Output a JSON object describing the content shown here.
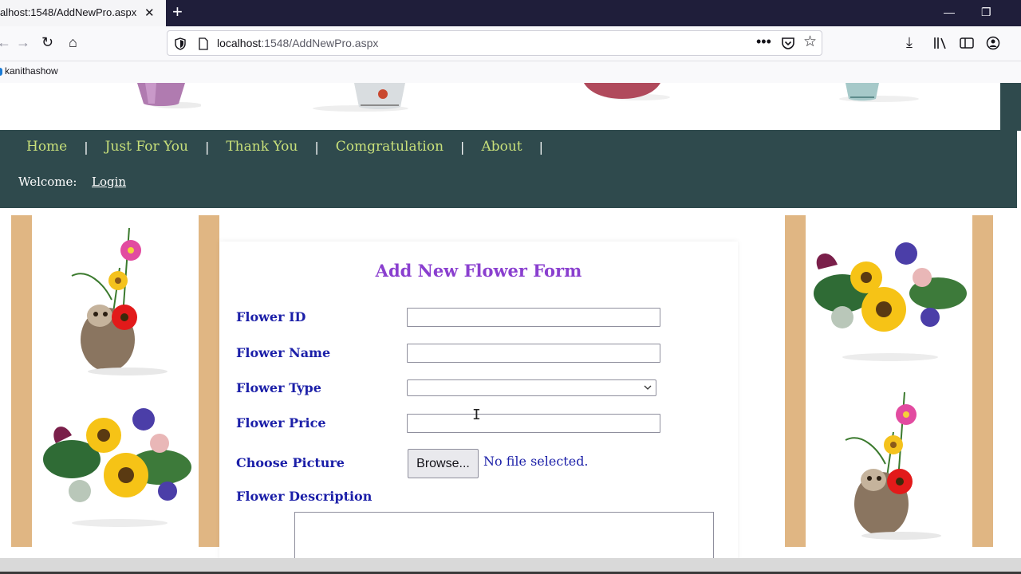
{
  "browser": {
    "tab_title": "alhost:1548/AddNewPro.aspx",
    "url_prefix": "localhost",
    "url_rest": ":1548/AddNewPro.aspx",
    "bookmark": "kanithashow"
  },
  "site": {
    "menu": [
      "Home",
      "Just For You",
      "Thank You",
      "Comgratulation",
      "About"
    ],
    "menu_separator": "|",
    "welcome_label": "Welcome:",
    "login_link": "Login"
  },
  "form": {
    "title": "Add New Flower Form",
    "labels": {
      "id": "Flower ID",
      "name": "Flower Name",
      "type": "Flower Type",
      "price": "Flower Price",
      "picture": "Choose Picture",
      "description": "Flower Description"
    },
    "values": {
      "id": "",
      "name": "",
      "type": "",
      "price": "",
      "description": ""
    },
    "browse_label": "Browse...",
    "no_file_text": "No file selected."
  },
  "colors": {
    "nav_bg": "#2f4a4d",
    "menu_link": "#c8e07a",
    "label": "#1b1fa8",
    "title": "#8a3fcf",
    "stripe": "#e0b683"
  }
}
